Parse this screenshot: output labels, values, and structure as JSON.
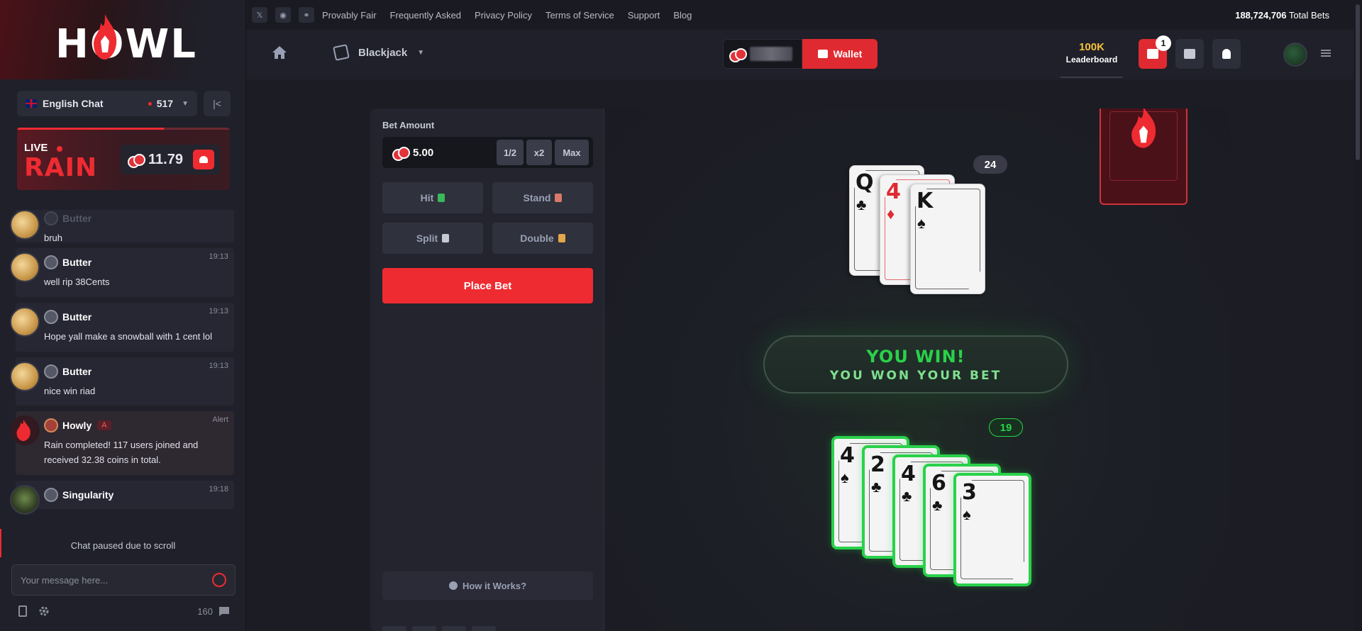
{
  "brand": {
    "logo_text": "HOWL"
  },
  "chat": {
    "room": "English Chat",
    "online": "517",
    "rain": {
      "live_label": "LIVE",
      "title": "RAIN",
      "amount": "11.79"
    },
    "messages": [
      {
        "user": "Butter",
        "time": "",
        "text": "bruh"
      },
      {
        "user": "Butter",
        "time": "19:13",
        "text": "well rip 38Cents"
      },
      {
        "user": "Butter",
        "time": "19:13",
        "text": "Hope yall make a snowball with 1 cent lol"
      },
      {
        "user": "Butter",
        "time": "19:13",
        "text": "nice win riad"
      },
      {
        "user": "Howly",
        "role": "A",
        "time": "Alert",
        "text": "Rain completed! 117 users joined and received 32.38 coins in total."
      },
      {
        "user": "Singularity",
        "time": "19:18",
        "text": ""
      }
    ],
    "paused_text": "Chat paused due to scroll",
    "input_placeholder": "Your message here...",
    "user_count": "160"
  },
  "topbar": {
    "links": [
      "Provably Fair",
      "Frequently Asked",
      "Privacy Policy",
      "Terms of Service",
      "Support",
      "Blog"
    ],
    "social_icons": [
      "x-icon",
      "discord-icon",
      "link-icon"
    ],
    "total_bets_value": "188,724,706",
    "total_bets_label": "Total Bets"
  },
  "header": {
    "game": "Blackjack",
    "wallet_label": "Wallet",
    "leaderboard_amount": "100K",
    "leaderboard_label": "Leaderboard",
    "rewards_badge": "1"
  },
  "controls": {
    "bet_label": "Bet Amount",
    "bet_value": "5.00",
    "half": "1/2",
    "double_bet": "x2",
    "max": "Max",
    "hit": "Hit",
    "stand": "Stand",
    "split": "Split",
    "double": "Double",
    "place_bet": "Place Bet",
    "how_it_works": "How it Works?"
  },
  "table": {
    "dealer_score": "24",
    "player_score": "19",
    "result_title": "YOU WIN!",
    "result_subtitle": "YOU WON YOUR BET",
    "dealer_cards": [
      {
        "rank": "Q",
        "suit": "♣",
        "color": "black"
      },
      {
        "rank": "4",
        "suit": "♦",
        "color": "red"
      },
      {
        "rank": "K",
        "suit": "♠",
        "color": "black"
      }
    ],
    "player_cards": [
      {
        "rank": "4",
        "suit": "♠",
        "color": "black"
      },
      {
        "rank": "2",
        "suit": "♣",
        "color": "black"
      },
      {
        "rank": "4",
        "suit": "♣",
        "color": "black"
      },
      {
        "rank": "6",
        "suit": "♣",
        "color": "black"
      },
      {
        "rank": "3",
        "suit": "♠",
        "color": "black"
      }
    ]
  },
  "colors": {
    "accent": "#ef2b32",
    "win": "#29d14a",
    "gold": "#f7c23a"
  }
}
